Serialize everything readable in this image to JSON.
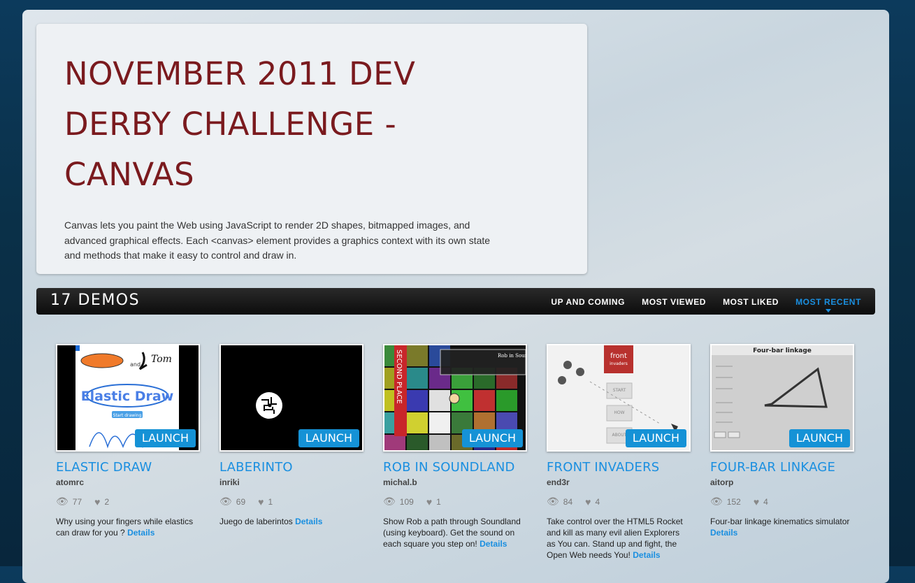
{
  "intro": {
    "title": "NOVEMBER 2011 DEV DERBY CHALLENGE - CANVAS",
    "description": "Canvas lets you paint the Web using JavaScript to render 2D shapes, bitmapped images, and advanced graphical effects. Each <canvas> element provides a graphics context with its own state and methods that make it easy to control and draw in."
  },
  "demos_bar": {
    "count": "17 DEMOS",
    "sorts": [
      "UP AND COMING",
      "MOST VIEWED",
      "MOST LIKED",
      "MOST RECENT"
    ],
    "active_sort": "MOST RECENT"
  },
  "launch_label": "LAUNCH",
  "details_label": "Details",
  "demos": [
    {
      "title": "ELASTIC DRAW",
      "author": "atomrc",
      "views": "77",
      "likes": "2",
      "desc": "Why using your fingers while elastics can draw for you ?",
      "thumb_text": "Elastic Draw",
      "thumb_sub": "Start drawing",
      "logo_text": "and",
      "logo_name": "Tom"
    },
    {
      "title": "LABERINTO",
      "author": "inriki",
      "views": "69",
      "likes": "1",
      "desc": "Juego de laberintos"
    },
    {
      "title": "ROB IN SOUNDLAND",
      "author": "michal.b",
      "views": "109",
      "likes": "1",
      "desc": "Show Rob a path through Soundland (using keyboard). Get the sound on each square you step on!",
      "ribbon": "SECOND PLACE",
      "panel_title": "Rob in Soundl"
    },
    {
      "title": "FRONT INVADERS",
      "author": "end3r",
      "views": "84",
      "likes": "4",
      "desc": "Take control over the HTML5 Rocket and kill as many evil alien Explorers as You can. Stand up and fight, the Open Web needs You!",
      "logo_top": "front",
      "logo_bottom": "invaders",
      "menu": [
        "START",
        "HOW",
        "ABOUT"
      ]
    },
    {
      "title": "FOUR-BAR LINKAGE",
      "author": "aitorp",
      "views": "152",
      "likes": "4",
      "desc": "Four-bar linkage kinematics simulator",
      "thumb_title": "Four-bar linkage"
    }
  ],
  "colors": {
    "accent": "#1a8fe0",
    "title_red": "#7a1a1e",
    "launch_blue": "#1592d6"
  }
}
